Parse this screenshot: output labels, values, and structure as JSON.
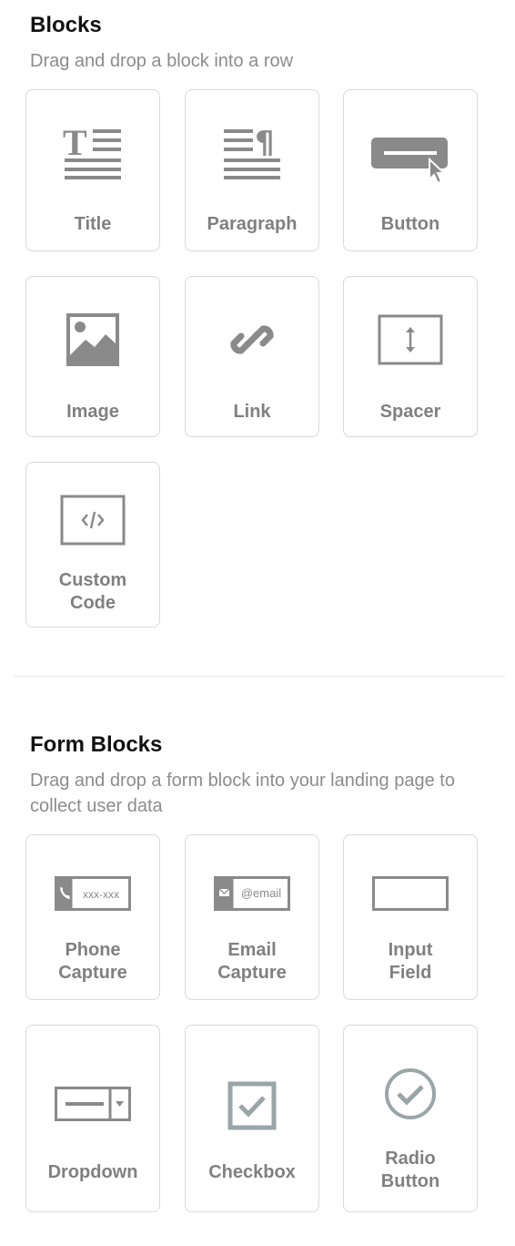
{
  "blocks": {
    "title": "Blocks",
    "subtitle": "Drag and drop a block into a row",
    "items": [
      {
        "label": "Title",
        "icon": "title-icon"
      },
      {
        "label": "Paragraph",
        "icon": "paragraph-icon"
      },
      {
        "label": "Button",
        "icon": "button-icon"
      },
      {
        "label": "Image",
        "icon": "image-icon"
      },
      {
        "label": "Link",
        "icon": "link-icon"
      },
      {
        "label": "Spacer",
        "icon": "spacer-icon"
      },
      {
        "label": "Custom\nCode",
        "icon": "code-icon"
      }
    ]
  },
  "form_blocks": {
    "title": "Form Blocks",
    "subtitle": "Drag and drop a form block into your landing page to collect user data",
    "items": [
      {
        "label": "Phone\nCapture",
        "icon": "phone-capture-icon",
        "icon_text": "xxx-xxx"
      },
      {
        "label": "Email\nCapture",
        "icon": "email-capture-icon",
        "icon_text": "@email"
      },
      {
        "label": "Input\nField",
        "icon": "input-field-icon"
      },
      {
        "label": "Dropdown",
        "icon": "dropdown-icon"
      },
      {
        "label": "Checkbox",
        "icon": "checkbox-icon"
      },
      {
        "label": "Radio\nButton",
        "icon": "radio-button-icon"
      }
    ]
  },
  "colors": {
    "icon_gray": "#8a8a8a",
    "icon_teal_gray": "#9aa5a8",
    "label_gray": "#808080",
    "border": "#d9d9d9"
  }
}
